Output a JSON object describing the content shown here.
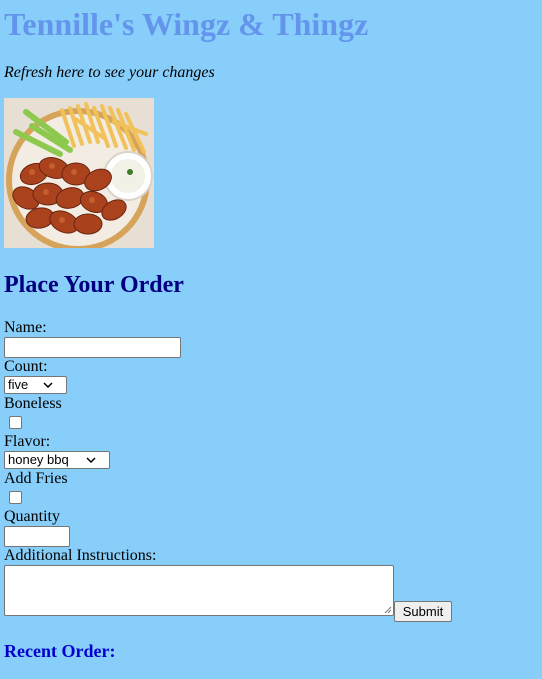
{
  "header": {
    "title": "Tennille's Wingz & Thingz",
    "refresh_note": "Refresh here to see your changes"
  },
  "hero_image": {
    "alt": "Plate of chicken wings with fries, celery and ranch dip"
  },
  "order_form": {
    "heading": "Place Your Order",
    "name": {
      "label": "Name:",
      "value": ""
    },
    "count": {
      "label": "Count:",
      "selected": "five"
    },
    "boneless": {
      "label": "Boneless",
      "checked": false
    },
    "flavor": {
      "label": "Flavor:",
      "selected": "honey bbq"
    },
    "fries": {
      "label": "Add Fries",
      "checked": false
    },
    "quantity": {
      "label": "Quantity",
      "value": ""
    },
    "instructions": {
      "label": "Additional Instructions:",
      "value": ""
    },
    "submit_label": "Submit"
  },
  "recent_order": {
    "heading": "Recent Order:"
  },
  "colors": {
    "background": "#87cefa",
    "title": "#6495ed",
    "order_heading": "#000080",
    "recent_heading": "#0000cd"
  },
  "icons": {
    "select_caret": "chevron-down-icon",
    "textarea_grip": "resize-grip-icon"
  }
}
